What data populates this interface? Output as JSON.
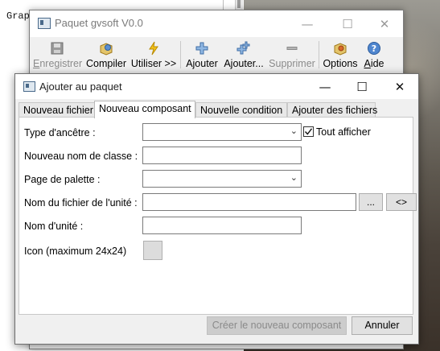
{
  "background": {
    "left_text": "Grap"
  },
  "main_window": {
    "title": "Paquet gvsoft V0.0",
    "controls": {
      "minimize": "—",
      "maximize": "☐",
      "close": "✕"
    },
    "toolbar": [
      {
        "label": "Enregistrer",
        "underline": "E",
        "rest": "nregistrer",
        "icon": "floppy-icon",
        "enabled": false
      },
      {
        "label": "Compiler",
        "icon": "compile-icon",
        "enabled": true
      },
      {
        "label": "Utiliser >>",
        "icon": "lightning-icon",
        "enabled": true
      },
      {
        "label": "Ajouter",
        "icon": "plus-icon",
        "enabled": true
      },
      {
        "label": "Ajouter...",
        "icon": "plus-multi-icon",
        "enabled": true
      },
      {
        "label": "Supprimer",
        "icon": "minus-icon",
        "enabled": false
      },
      {
        "label": "Options",
        "icon": "options-icon",
        "enabled": true
      },
      {
        "label": "Aide",
        "underline": "A",
        "rest": "ide",
        "icon": "help-icon",
        "enabled": true
      }
    ]
  },
  "dialog": {
    "title": "Ajouter au paquet",
    "controls": {
      "minimize": "—",
      "maximize": "☐",
      "close": "✕"
    },
    "tabs": [
      {
        "label": "Nouveau fichier",
        "active": false
      },
      {
        "label": "Nouveau composant",
        "active": true
      },
      {
        "label": "Nouvelle condition",
        "active": false
      },
      {
        "label": "Ajouter des fichiers",
        "active": false
      }
    ],
    "form": {
      "ancestor_label": "Type d'ancêtre :",
      "ancestor_value": "",
      "show_all_label": "Tout afficher",
      "show_all_checked": true,
      "class_name_label": "Nouveau nom de classe :",
      "class_name_value": "",
      "palette_label": "Page de palette :",
      "palette_value": "",
      "unit_file_label": "Nom du fichier de l'unité :",
      "unit_file_value": "",
      "browse_button": "...",
      "shorten_button": "<>",
      "unit_name_label": "Nom d'unité :",
      "unit_name_value": "",
      "icon_label": "Icon (maximum 24x24)"
    },
    "buttons": {
      "create": "Créer le nouveau composant",
      "cancel": "Annuler"
    }
  }
}
